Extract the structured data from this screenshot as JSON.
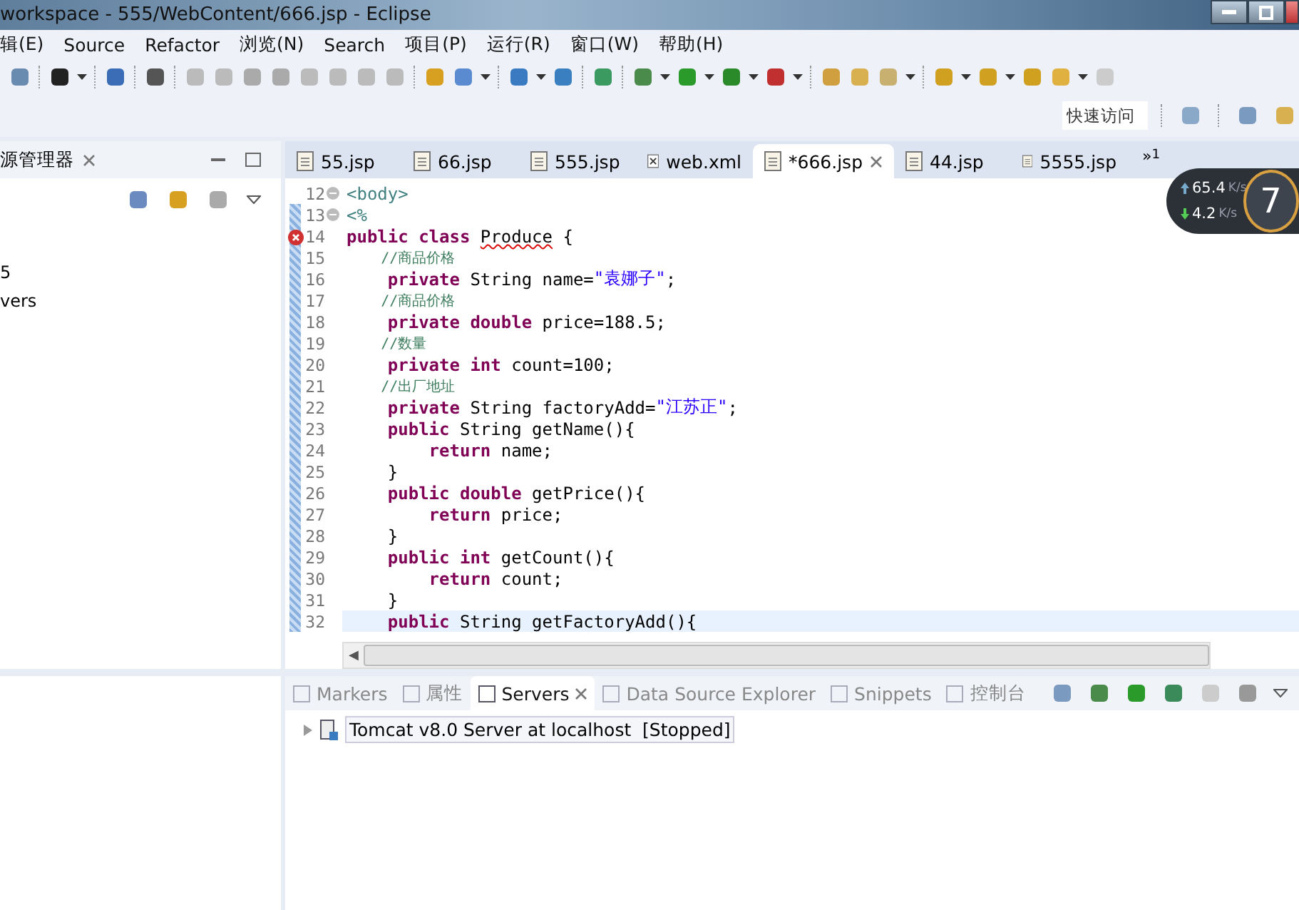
{
  "window": {
    "title": "workspace - 555/WebContent/666.jsp - Eclipse"
  },
  "menu": [
    "辑(E)",
    "Source",
    "Refactor",
    "浏览(N)",
    "Search",
    "项目(P)",
    "运行(R)",
    "窗口(W)",
    "帮助(H)"
  ],
  "quick_access": {
    "placeholder": "快速访问"
  },
  "explorer": {
    "title": "源管理器",
    "items": [
      "5",
      "vers"
    ]
  },
  "editor_tabs": [
    {
      "label": "55.jsp",
      "kind": "jsp",
      "selected": false
    },
    {
      "label": "66.jsp",
      "kind": "jsp",
      "selected": false
    },
    {
      "label": "555.jsp",
      "kind": "jsp",
      "selected": false
    },
    {
      "label": "web.xml",
      "kind": "xml",
      "selected": false
    },
    {
      "label": "*666.jsp",
      "kind": "jsp",
      "selected": true
    },
    {
      "label": "44.jsp",
      "kind": "jsp",
      "selected": false
    },
    {
      "label": "5555.jsp",
      "kind": "jsp",
      "selected": false
    }
  ],
  "overflow": {
    "symbol": "»",
    "count": "1"
  },
  "code": [
    {
      "number": "12",
      "fold": true,
      "error": false,
      "current": false,
      "tokens": [
        {
          "kind": "tag",
          "text": "<body>"
        }
      ]
    },
    {
      "number": "13",
      "fold": true,
      "error": false,
      "current": false,
      "tokens": [
        {
          "kind": "tag",
          "text": "<%"
        }
      ]
    },
    {
      "number": "14",
      "fold": false,
      "error": true,
      "current": false,
      "tokens": [
        {
          "kind": "kw",
          "text": "public class "
        },
        {
          "kind": "squiggle",
          "text": "Produce"
        },
        {
          "kind": "plain",
          "text": " {"
        }
      ]
    },
    {
      "number": "15",
      "fold": false,
      "error": false,
      "current": false,
      "tokens": [
        {
          "kind": "comment",
          "text": "    //商品价格"
        }
      ]
    },
    {
      "number": "16",
      "fold": false,
      "error": false,
      "current": false,
      "tokens": [
        {
          "kind": "kw",
          "text": "    private"
        },
        {
          "kind": "plain",
          "text": " String name="
        },
        {
          "kind": "string",
          "text": "\"袁娜子\""
        },
        {
          "kind": "plain",
          "text": ";"
        }
      ]
    },
    {
      "number": "17",
      "fold": false,
      "error": false,
      "current": false,
      "tokens": [
        {
          "kind": "comment",
          "text": "    //商品价格"
        }
      ]
    },
    {
      "number": "18",
      "fold": false,
      "error": false,
      "current": false,
      "tokens": [
        {
          "kind": "kw",
          "text": "    private double"
        },
        {
          "kind": "plain",
          "text": " price=188.5;"
        }
      ]
    },
    {
      "number": "19",
      "fold": false,
      "error": false,
      "current": false,
      "tokens": [
        {
          "kind": "comment",
          "text": "    //数量"
        }
      ]
    },
    {
      "number": "20",
      "fold": false,
      "error": false,
      "current": false,
      "tokens": [
        {
          "kind": "kw",
          "text": "    private int"
        },
        {
          "kind": "plain",
          "text": " count=100;"
        }
      ]
    },
    {
      "number": "21",
      "fold": false,
      "error": false,
      "current": false,
      "tokens": [
        {
          "kind": "comment",
          "text": "    //出厂地址"
        }
      ]
    },
    {
      "number": "22",
      "fold": false,
      "error": false,
      "current": false,
      "tokens": [
        {
          "kind": "kw",
          "text": "    private"
        },
        {
          "kind": "plain",
          "text": " String factoryAdd="
        },
        {
          "kind": "string",
          "text": "\"江苏正\""
        },
        {
          "kind": "plain",
          "text": ";"
        }
      ]
    },
    {
      "number": "23",
      "fold": false,
      "error": false,
      "current": false,
      "tokens": [
        {
          "kind": "kw",
          "text": "    public"
        },
        {
          "kind": "plain",
          "text": " String getName(){"
        }
      ]
    },
    {
      "number": "24",
      "fold": false,
      "error": false,
      "current": false,
      "tokens": [
        {
          "kind": "kw",
          "text": "        return"
        },
        {
          "kind": "plain",
          "text": " name;"
        }
      ]
    },
    {
      "number": "25",
      "fold": false,
      "error": false,
      "current": false,
      "tokens": [
        {
          "kind": "plain",
          "text": "    }"
        }
      ]
    },
    {
      "number": "26",
      "fold": false,
      "error": false,
      "current": false,
      "tokens": [
        {
          "kind": "kw",
          "text": "    public double"
        },
        {
          "kind": "plain",
          "text": " getPrice(){"
        }
      ]
    },
    {
      "number": "27",
      "fold": false,
      "error": false,
      "current": false,
      "tokens": [
        {
          "kind": "kw",
          "text": "        return"
        },
        {
          "kind": "plain",
          "text": " price;"
        }
      ]
    },
    {
      "number": "28",
      "fold": false,
      "error": false,
      "current": false,
      "tokens": [
        {
          "kind": "plain",
          "text": "    }"
        }
      ]
    },
    {
      "number": "29",
      "fold": false,
      "error": false,
      "current": false,
      "tokens": [
        {
          "kind": "kw",
          "text": "    public int"
        },
        {
          "kind": "plain",
          "text": " getCount(){"
        }
      ]
    },
    {
      "number": "30",
      "fold": false,
      "error": false,
      "current": false,
      "tokens": [
        {
          "kind": "kw",
          "text": "        return"
        },
        {
          "kind": "plain",
          "text": " count;"
        }
      ]
    },
    {
      "number": "31",
      "fold": false,
      "error": false,
      "current": false,
      "tokens": [
        {
          "kind": "plain",
          "text": "    }"
        }
      ]
    },
    {
      "number": "32",
      "fold": false,
      "error": false,
      "current": true,
      "tokens": [
        {
          "kind": "kw",
          "text": "    public"
        },
        {
          "kind": "plain",
          "text": " String getFactoryAdd(){"
        }
      ]
    }
  ],
  "scroll_arrow": "◀",
  "net_widget": {
    "up": "65.4",
    "up_unit": "K/s",
    "down": "4.2",
    "down_unit": "K/s",
    "gauge": "7"
  },
  "bottom_tabs": [
    {
      "label": "Markers",
      "selected": false
    },
    {
      "label": "属性",
      "selected": false
    },
    {
      "label": "Servers",
      "selected": true
    },
    {
      "label": "Data Source Explorer",
      "selected": false
    },
    {
      "label": "Snippets",
      "selected": false
    },
    {
      "label": "控制台",
      "selected": false
    }
  ],
  "servers": [
    {
      "label": "Tomcat v8.0 Server at localhost  [Stopped]",
      "expanded": false
    }
  ]
}
